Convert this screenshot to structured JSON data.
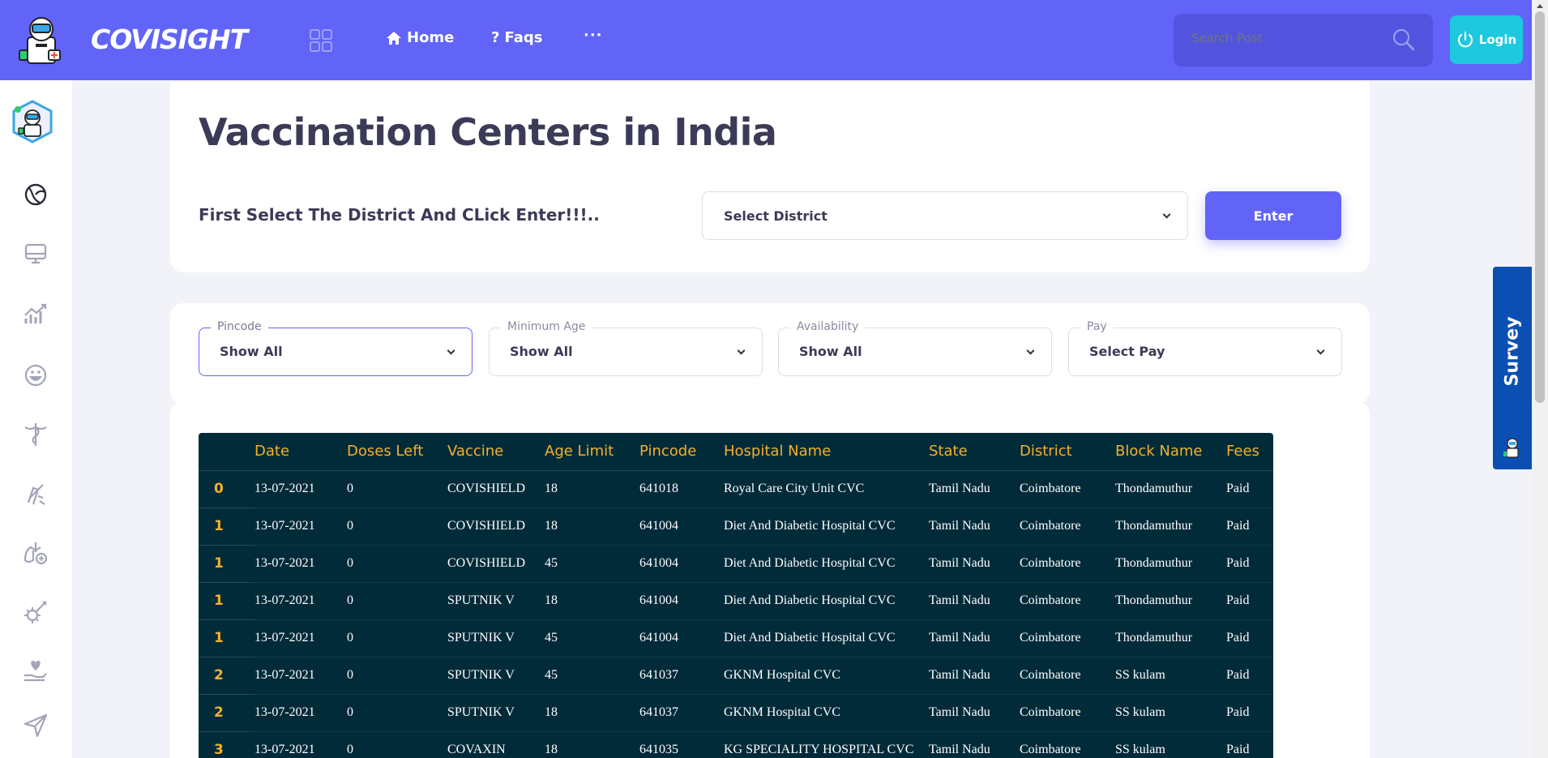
{
  "brand": {
    "name": "COVISIGHT"
  },
  "nav": {
    "home": "Home",
    "faqs": "Faqs",
    "more": "···"
  },
  "search": {
    "placeholder": "Search Post"
  },
  "login": {
    "label": "Login"
  },
  "page": {
    "title": "Vaccination Centers in India",
    "instruction": "First Select The District And CLick Enter!!!..",
    "district_select": "Select District",
    "enter_label": "Enter"
  },
  "filters": [
    {
      "label": "Pincode",
      "value": "Show All"
    },
    {
      "label": "Minimum Age",
      "value": "Show All"
    },
    {
      "label": "Availability",
      "value": "Show All"
    },
    {
      "label": "Pay",
      "value": "Select Pay"
    }
  ],
  "table": {
    "headers": [
      "",
      "Date",
      "Doses Left",
      "Vaccine",
      "Age Limit",
      "Pincode",
      "Hospital Name",
      "State",
      "District",
      "Block Name",
      "Fees"
    ],
    "rows": [
      [
        "0",
        "13-07-2021",
        "0",
        "COVISHIELD",
        "18",
        "641018",
        "Royal Care City Unit CVC",
        "Tamil Nadu",
        "Coimbatore",
        "Thondamuthur",
        "Paid"
      ],
      [
        "1",
        "13-07-2021",
        "0",
        "COVISHIELD",
        "18",
        "641004",
        "Diet And Diabetic Hospital CVC",
        "Tamil Nadu",
        "Coimbatore",
        "Thondamuthur",
        "Paid"
      ],
      [
        "1",
        "13-07-2021",
        "0",
        "COVISHIELD",
        "45",
        "641004",
        "Diet And Diabetic Hospital CVC",
        "Tamil Nadu",
        "Coimbatore",
        "Thondamuthur",
        "Paid"
      ],
      [
        "1",
        "13-07-2021",
        "0",
        "SPUTNIK V",
        "18",
        "641004",
        "Diet And Diabetic Hospital CVC",
        "Tamil Nadu",
        "Coimbatore",
        "Thondamuthur",
        "Paid"
      ],
      [
        "1",
        "13-07-2021",
        "0",
        "SPUTNIK V",
        "45",
        "641004",
        "Diet And Diabetic Hospital CVC",
        "Tamil Nadu",
        "Coimbatore",
        "Thondamuthur",
        "Paid"
      ],
      [
        "2",
        "13-07-2021",
        "0",
        "SPUTNIK V",
        "45",
        "641037",
        "GKNM Hospital CVC",
        "Tamil Nadu",
        "Coimbatore",
        "SS kulam",
        "Paid"
      ],
      [
        "2",
        "13-07-2021",
        "0",
        "SPUTNIK V",
        "18",
        "641037",
        "GKNM Hospital CVC",
        "Tamil Nadu",
        "Coimbatore",
        "SS kulam",
        "Paid"
      ],
      [
        "3",
        "13-07-2021",
        "0",
        "COVAXIN",
        "18",
        "641035",
        "KG SPECIALITY HOSPITAL CVC",
        "Tamil Nadu",
        "Coimbatore",
        "SS kulam",
        "Paid"
      ]
    ]
  },
  "survey": {
    "label": "Survey"
  },
  "sidebar": {
    "icons": [
      "globe-icon",
      "monitor-icon",
      "chart-icon",
      "mask-icon",
      "caduceus-icon",
      "microscope-icon",
      "lungs-icon",
      "virus-syringe-icon",
      "heart-hand-icon",
      "send-icon"
    ]
  },
  "colors": {
    "primary": "#6164f7",
    "accent": "#1ec8de",
    "table_bg": "#022b3a",
    "table_header": "#f5b02a",
    "survey": "#0b4fb3"
  }
}
